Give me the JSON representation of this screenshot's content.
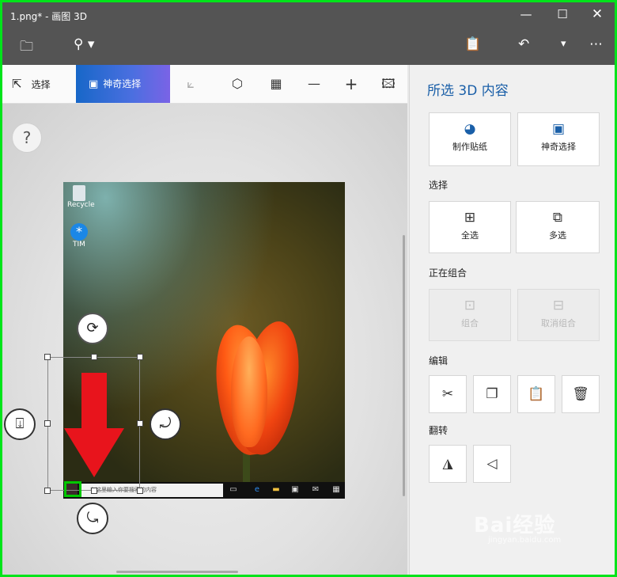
{
  "window": {
    "title": "1.png* - 画图 3D",
    "minimize_glyph": "—",
    "maximize_glyph": "☐",
    "close_glyph": "✕"
  },
  "command_bar": {
    "icons": [
      "folder-icon",
      "location-pin-icon",
      "paste-icon",
      "undo-icon",
      "chevron-down-icon",
      "more-icon"
    ],
    "folder_glyph": "🗀",
    "pin_glyph": "⚲ ▾",
    "paste_glyph": "📋",
    "undo_glyph": "↶",
    "dropdown_glyph": "▾",
    "more_glyph": "⋯"
  },
  "toolbar": {
    "select_label": "选择",
    "select_glyph": "⇱",
    "magic_select_label": "神奇选择",
    "magic_select_glyph": "▣",
    "crop_glyph": "⟀",
    "view3d_glyph": "⬡",
    "grid_glyph": "▦",
    "zoom_out_glyph": "—",
    "zoom_in_glyph": "+",
    "image_glyph": "🖾"
  },
  "canvas": {
    "help_glyph": "?",
    "desktop_icons": [
      {
        "label": "Recycle"
      },
      {
        "label": "TIM"
      }
    ],
    "taskbar_search_text": "在这里输入你要搜索的内容",
    "rotate_icons": {
      "top": "⟳",
      "left": "⍗",
      "right": "⤾",
      "bottom": "⤿"
    },
    "accent_arrow_color": "#e8141c",
    "selection_color": "#00c800"
  },
  "panel": {
    "title": "所选 3D 内容",
    "top_buttons": [
      {
        "label": "制作贴纸",
        "glyph": "◕"
      },
      {
        "label": "神奇选择",
        "glyph": "▣"
      }
    ],
    "select_section": "选择",
    "select_buttons": [
      {
        "label": "全选",
        "glyph": "⊞"
      },
      {
        "label": "多选",
        "glyph": "⧉"
      }
    ],
    "group_section": "正在组合",
    "group_buttons": [
      {
        "label": "组合",
        "glyph": "⊡"
      },
      {
        "label": "取消组合",
        "glyph": "⊟"
      }
    ],
    "edit_section": "编辑",
    "edit_icons": [
      {
        "name": "cut-icon",
        "glyph": "✂"
      },
      {
        "name": "copy-icon",
        "glyph": "❐"
      },
      {
        "name": "paste-icon",
        "glyph": "📋"
      },
      {
        "name": "delete-icon",
        "glyph": "🗑"
      }
    ],
    "flip_section": "翻转",
    "flip_icons": [
      {
        "name": "flip-horizontal-icon",
        "glyph": "◮"
      },
      {
        "name": "flip-vertical-icon",
        "glyph": "◁"
      }
    ]
  },
  "watermark": {
    "brand": "Bai经验",
    "url": "jingyan.baidu.com"
  }
}
